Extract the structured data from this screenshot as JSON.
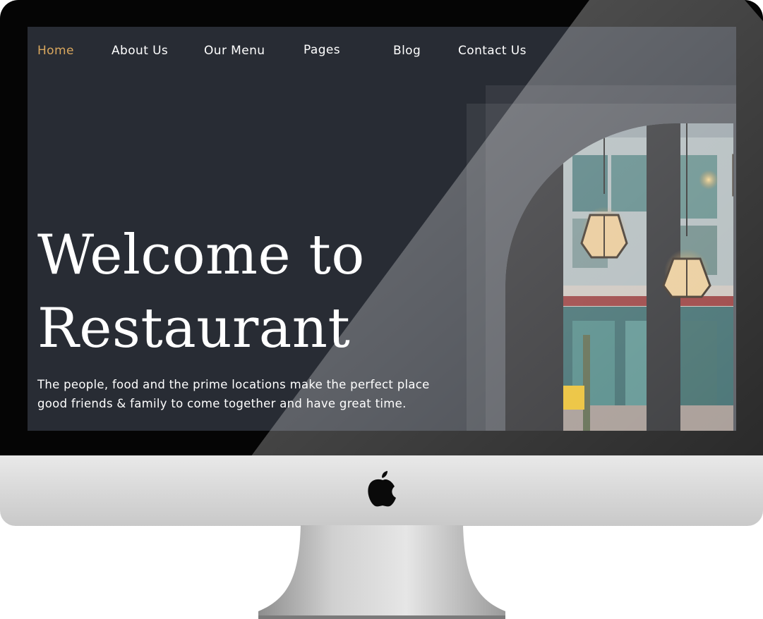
{
  "nav": {
    "items": [
      {
        "label": "Home",
        "active": true
      },
      {
        "label": "About Us",
        "active": false
      },
      {
        "label": "Our Menu",
        "active": false
      },
      {
        "label": "Pages",
        "active": false
      },
      {
        "label": "Blog",
        "active": false
      },
      {
        "label": "Contact Us",
        "active": false
      }
    ]
  },
  "hero": {
    "title_line1": "Welcome to",
    "title_line2": "Restaurant",
    "description_line1": "The people, food and the prime locations make the perfect place",
    "description_line2": "good friends & family to come together and have great time."
  },
  "colors": {
    "background": "#282c34",
    "accent": "#d9a75e",
    "text": "#ffffff"
  },
  "icons": {
    "brand": "apple-logo-icon"
  }
}
